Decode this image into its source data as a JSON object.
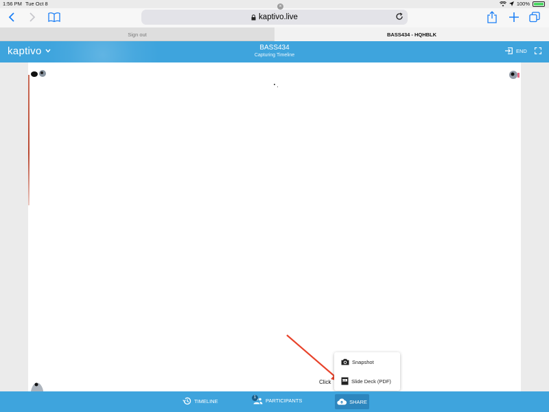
{
  "status_bar": {
    "time": "1:56 PM",
    "date": "Tue Oct 8",
    "battery": "100%"
  },
  "browser": {
    "url": "kaptivo.live"
  },
  "tabs": [
    {
      "label": "Sign out"
    },
    {
      "label": "BASS434 - HQHBLK"
    }
  ],
  "app_header": {
    "logo": "kaptivo",
    "title": "BASS434",
    "subtitle": "Capturing Timeline",
    "end_label": "END"
  },
  "share_menu": {
    "items": [
      {
        "label": "Snapshot",
        "icon": "camera-icon"
      },
      {
        "label": "Slide Deck (PDF)",
        "icon": "pdf-icon"
      }
    ]
  },
  "annotation": {
    "click_label": "Click",
    "arrow_color": "#e8432b"
  },
  "bottom_bar": {
    "timeline_label": "TIMELINE",
    "participants_label": "PARTICIPANTS",
    "participants_badge": "1",
    "share_label": "SHARE"
  },
  "colors": {
    "accent": "#3ea4dd",
    "share_active": "#2d86be"
  }
}
